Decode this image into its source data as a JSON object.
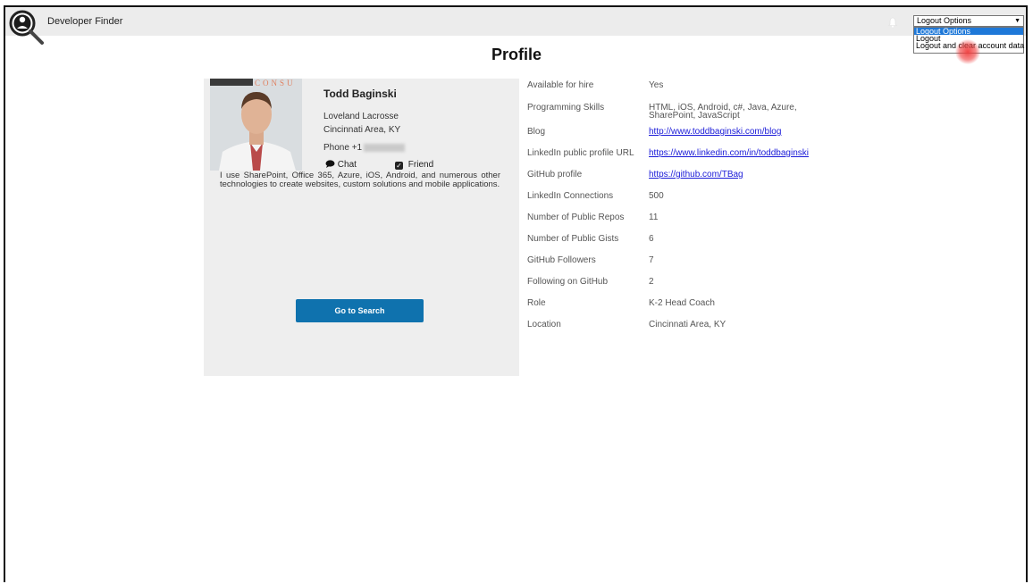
{
  "header": {
    "app_title": "Developer Finder",
    "logout_select": {
      "selected": "Logout Options",
      "options": [
        "Logout Options",
        "Logout",
        "Logout and clear account data"
      ]
    }
  },
  "page_title": "Profile",
  "profile": {
    "name": "Todd Baginski",
    "company": "Loveland Lacrosse",
    "location": "Cincinnati Area, KY",
    "phone_prefix": "Phone +1",
    "chat_label": "Chat",
    "friend_label": "Friend",
    "bio": "I use SharePoint, Office 365, Azure, iOS, Android, and numerous other technologies to create websites, custom solutions and mobile applications.",
    "go_to_search": "Go to Search",
    "photo_banner_text": "CONSU"
  },
  "details": [
    {
      "label": "Available for hire",
      "value": "Yes"
    },
    {
      "label": "Programming Skills",
      "value": "HTML, iOS, Android, c#, Java, Azure, SharePoint, JavaScript"
    },
    {
      "label": "Blog",
      "value": "http://www.toddbaginski.com/blog",
      "link": true
    },
    {
      "label": "LinkedIn public profile URL",
      "value": "https://www.linkedin.com/in/toddbaginski",
      "link": true
    },
    {
      "label": "GitHub profile",
      "value": "https://github.com/TBag",
      "link": true
    },
    {
      "label": "LinkedIn Connections",
      "value": "500"
    },
    {
      "label": "Number of Public Repos",
      "value": "11"
    },
    {
      "label": "Number of Public Gists",
      "value": "6"
    },
    {
      "label": "GitHub Followers",
      "value": "7"
    },
    {
      "label": "Following on GitHub",
      "value": "2"
    },
    {
      "label": "Role",
      "value": "K-2 Head Coach"
    },
    {
      "label": "Location",
      "value": "Cincinnati Area, KY"
    }
  ],
  "colors": {
    "header_bg": "#ececec",
    "button_bg": "#0f72ae",
    "link": "#1a1ad8",
    "dropdown_highlight": "#1e78d8"
  }
}
